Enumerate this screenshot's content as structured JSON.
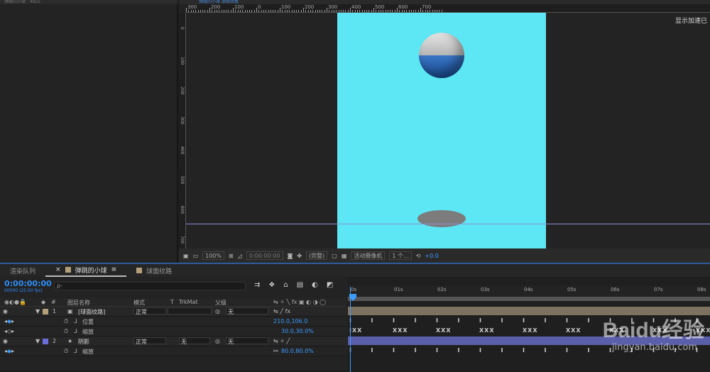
{
  "left_panel": {
    "header": "弹跳的小球 · 4925"
  },
  "viewer": {
    "tab_label": "弹跳的小球   球面纹路",
    "hw_accel_label": "显示加速已",
    "ruler_labels": [
      "300",
      "200",
      "100",
      "0",
      "100",
      "200",
      "300",
      "400",
      "500",
      "600",
      "700"
    ],
    "vruler_labels": [
      "0",
      "100",
      "200",
      "300",
      "400",
      "500",
      "600",
      "700"
    ],
    "bar": {
      "zoom": "100%",
      "timecode": "0:00:00:00",
      "resolution": "(完整)",
      "camera": "活动摄像机",
      "views": "1 个...",
      "exposure": "+0.0"
    }
  },
  "timeline": {
    "tabs": [
      {
        "label": "渲染队列",
        "color": ""
      },
      {
        "label": "弹跳的小球",
        "color": "#b3a07a"
      },
      {
        "label": "球面纹路",
        "color": "#b3a07a"
      }
    ],
    "timecode": "0:00:00:00",
    "fps": "00000 (25.00 fps)",
    "search_placeholder": "ρ-",
    "columns": {
      "num": "#",
      "name": "图层名称",
      "mode": "模式",
      "t": "T",
      "trkmat": "TrkMat",
      "parent": "父级"
    },
    "rows": [
      {
        "num": "1",
        "name": "[球面纹路]",
        "mode": "正常",
        "trkmat": "",
        "parent": "无",
        "color": "#b3a07a"
      },
      {
        "name": "位置",
        "value": "210.0,106.0"
      },
      {
        "name": "缩放",
        "value": "30.0,30.0%"
      },
      {
        "num": "2",
        "name": "阴影",
        "mode": "正常",
        "trkmat": "无",
        "parent": "无",
        "color": "#6a6ed6"
      },
      {
        "name": "缩放",
        "value": "80.0,80.0%"
      }
    ],
    "ruler_labels": [
      "0s",
      "01s",
      "02s",
      "03s",
      "04s",
      "05s",
      "06s",
      "07s",
      "08s"
    ],
    "kf_row1": [
      "I",
      "I",
      "I",
      "I",
      "I",
      "I",
      "I",
      "I",
      "I",
      "I",
      "I",
      "I",
      "I",
      "I",
      "I",
      "I",
      "I"
    ],
    "kf_row2": [
      "IXX",
      "XXX",
      "XXX",
      "XXX",
      "XXX",
      "XXX",
      "XXX",
      "XXX",
      "XXX"
    ],
    "kf_row3": [
      "I",
      "I",
      "I",
      "I",
      "I",
      "I",
      "I",
      "I",
      "I",
      "I",
      "I",
      "I",
      "I",
      "I",
      "I",
      "I",
      "I"
    ]
  },
  "watermark": {
    "brand": "Baidu经验",
    "url": "jingyan.baidu.com"
  },
  "colors": {
    "comp_bg": "#5de6f3",
    "accent": "#3d9cff",
    "layer1": "#b3a07a",
    "layer2": "#6a6ed6"
  }
}
